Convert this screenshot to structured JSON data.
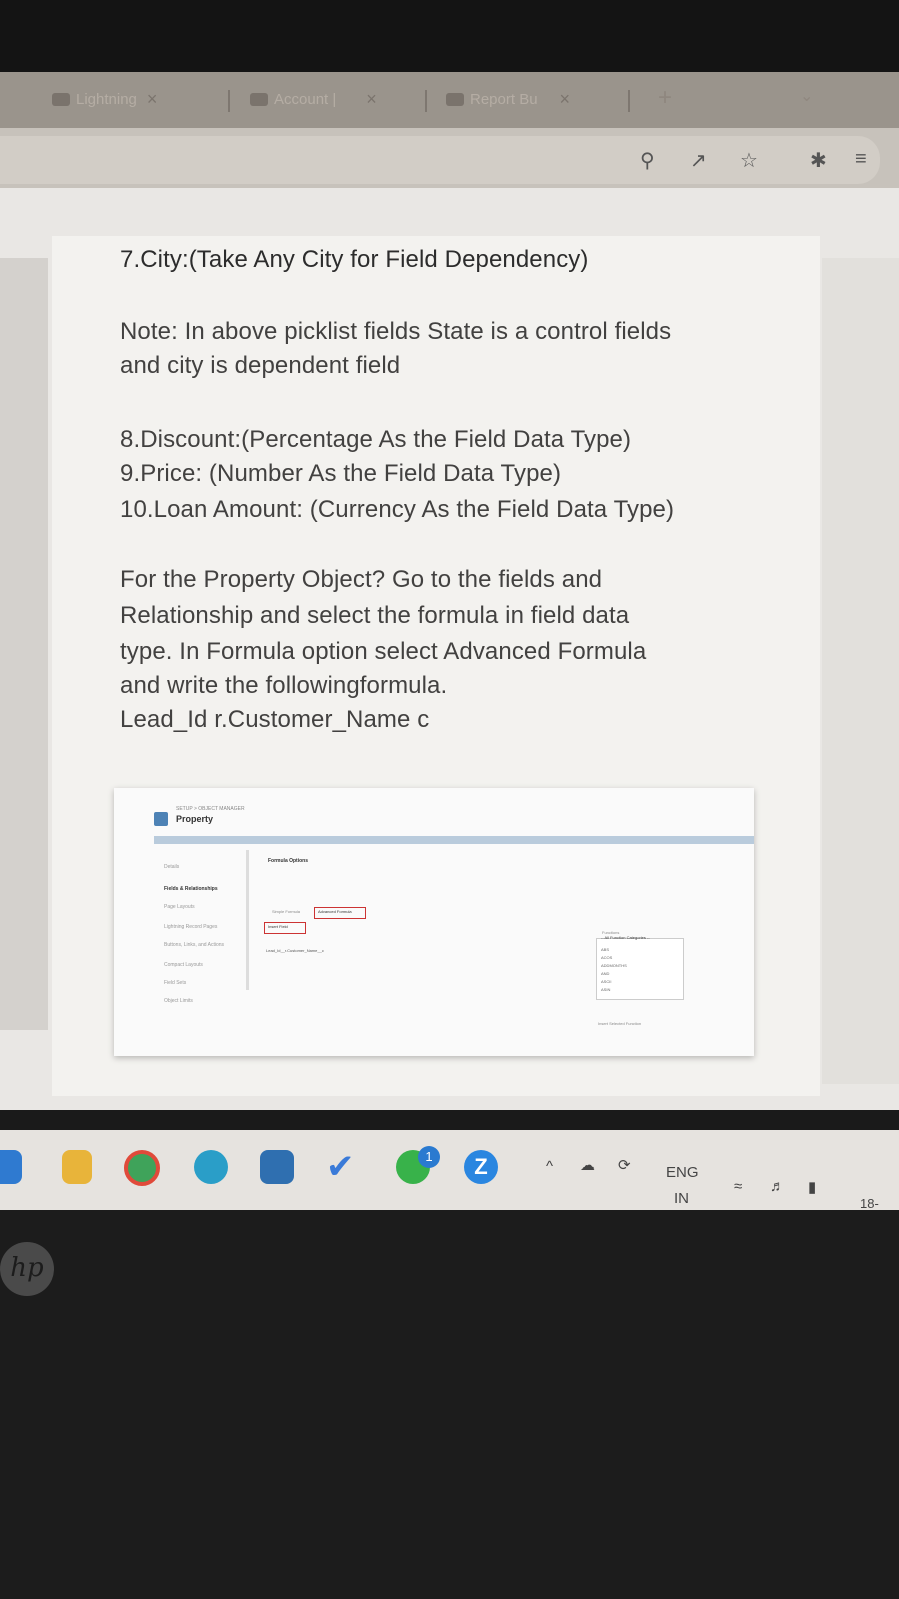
{
  "browser": {
    "tabs": [
      {
        "label": "Lightning"
      },
      {
        "label": "Account |"
      },
      {
        "label": "Report Bu"
      }
    ],
    "tab_close": "×",
    "new_tab": "+"
  },
  "document": {
    "lines": [
      "7.City:(Take Any City for Field Dependency)",
      "Note: In above picklist fields State is a control fields",
      "and city is dependent field",
      "8.Discount:(Percentage As the Field Data Type)",
      "9.Price: (Number As the Field Data Type)",
      "10.Loan Amount: (Currency As the Field Data Type)",
      "For the Property Object? Go to the fields and",
      "Relationship and select the formula in field data",
      "type. In Formula option select Advanced Formula",
      "and write the followingformula.",
      "Lead_Id r.Customer_Name  c"
    ]
  },
  "embedded_screenshot": {
    "breadcrumb": "SETUP > OBJECT MANAGER",
    "title": "Property",
    "nav": [
      "Details",
      "Fields & Relationships",
      "Page Layouts",
      "Lightning Record Pages",
      "Buttons, Links, and Actions",
      "Compact Layouts",
      "Field Sets",
      "Object Limits"
    ],
    "formula_options": "Formula Options",
    "simple_formula": "Simple Formula",
    "advanced_formula": "Advanced Formula",
    "insert_field": "Insert Field",
    "formula_text": "Lead_Id__r.Customer_Name__c",
    "functions": "Functions",
    "all_categories": "-- All Function Categories --",
    "function_list": [
      "ABS",
      "ACOS",
      "ADDMONTHS",
      "AND",
      "ASCII",
      "ASIN"
    ],
    "insert_selected": "Insert Selected Function"
  },
  "taskbar": {
    "lang_top": "ENG",
    "lang_bottom": "IN",
    "clock_partial": "18-",
    "badge": "1",
    "caret": "^"
  },
  "device": {
    "brand": "hp"
  }
}
